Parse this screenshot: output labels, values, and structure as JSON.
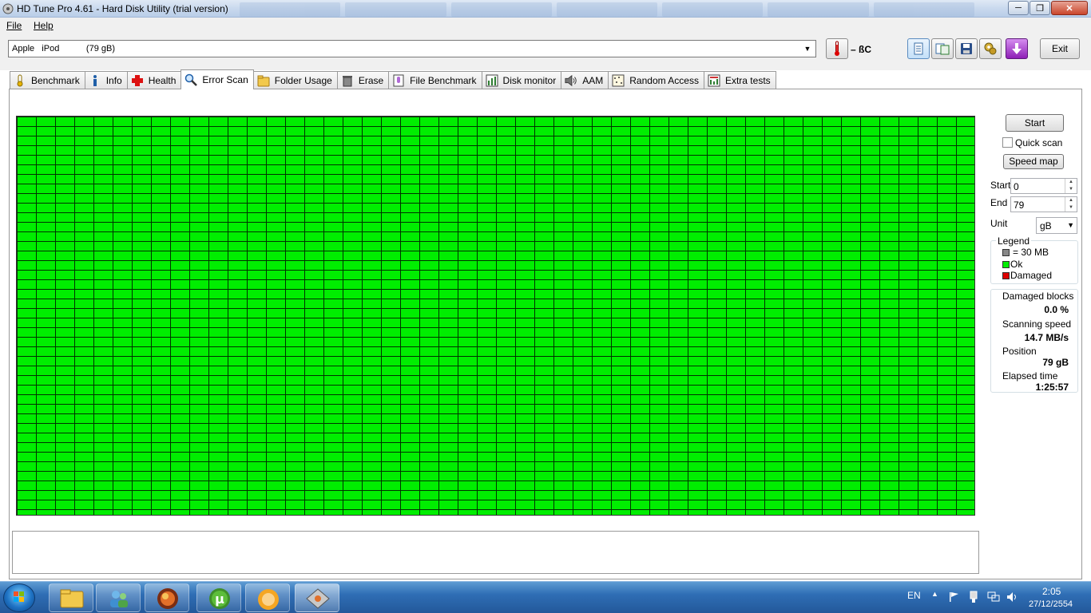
{
  "window": {
    "title": "HD Tune Pro 4.61 - Hard Disk Utility (trial version)",
    "minimize_label": "─",
    "maximize_label": "❐",
    "close_label": "✕"
  },
  "menu": {
    "file": "File",
    "help": "Help"
  },
  "toolbar": {
    "drive": "Apple   iPod           (79 gB)",
    "temperature": "– ßC",
    "exit_label": "Exit"
  },
  "tabs": [
    {
      "label": "Benchmark",
      "icon": "benchmark-icon"
    },
    {
      "label": "Info",
      "icon": "info-icon"
    },
    {
      "label": "Health",
      "icon": "health-icon"
    },
    {
      "label": "Error Scan",
      "icon": "magnifier-icon",
      "active": true
    },
    {
      "label": "Folder Usage",
      "icon": "folder-icon"
    },
    {
      "label": "Erase",
      "icon": "trash-icon"
    },
    {
      "label": "File Benchmark",
      "icon": "file-benchmark-icon"
    },
    {
      "label": "Disk monitor",
      "icon": "disk-monitor-icon"
    },
    {
      "label": "AAM",
      "icon": "speaker-icon"
    },
    {
      "label": "Random Access",
      "icon": "random-access-icon"
    },
    {
      "label": "Extra tests",
      "icon": "extra-tests-icon"
    }
  ],
  "scan": {
    "start_button": "Start",
    "quick_scan_label": "Quick scan",
    "quick_scan_checked": false,
    "speed_map_button": "Speed map",
    "start_label": "Start",
    "start_value": "0",
    "end_label": "End",
    "end_value": "79",
    "unit_label": "Unit",
    "unit_value": "gB",
    "block_status": "ok",
    "ok_color": "#00ee00",
    "damaged_color": "#dd0000"
  },
  "legend": {
    "title": "Legend",
    "block_size": "= 30 MB",
    "ok": "Ok",
    "damaged": "Damaged"
  },
  "stats": {
    "damaged_blocks_label": "Damaged blocks",
    "damaged_blocks_value": "0.0 %",
    "scanning_speed_label": "Scanning speed",
    "scanning_speed_value": "14.7 MB/s",
    "position_label": "Position",
    "position_value": "79 gB",
    "elapsed_label": "Elapsed time",
    "elapsed_value": "1:25:57"
  },
  "taskbar": {
    "language": "EN",
    "time": "2:05",
    "date": "27/12/2554"
  }
}
